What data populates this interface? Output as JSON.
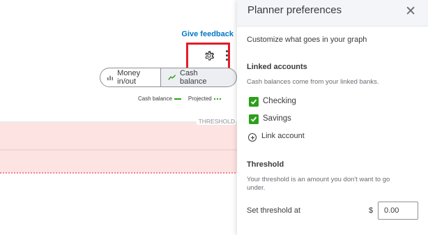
{
  "left": {
    "feedback_label": "Give feedback",
    "toggle": {
      "money_label": "Money in/out",
      "cash_label": "Cash balance"
    },
    "legend": {
      "cash_balance": "Cash balance",
      "projected": "Projected"
    },
    "threshold_label": "THRESHOLD"
  },
  "panel": {
    "title": "Planner preferences",
    "close_glyph": "✕",
    "customize": "Customize what goes in your graph",
    "linked": {
      "heading": "Linked accounts",
      "description": "Cash balances come from your linked banks.",
      "accounts": [
        {
          "label": "Checking",
          "checked": true
        },
        {
          "label": "Savings",
          "checked": true
        }
      ],
      "link_account": "Link account"
    },
    "threshold": {
      "heading": "Threshold",
      "description_line1": "Your threshold is an amount you don't want to go",
      "description_line2": "under.",
      "set_label": "Set threshold at",
      "currency": "$",
      "value": "0.00"
    }
  },
  "colors": {
    "accent_green": "#2ca01c",
    "link_blue": "#0077c5",
    "highlight_red": "#e31d2a",
    "threshold_fill": "#fde3e1"
  },
  "icons": [
    "gear-icon",
    "more-vertical-icon",
    "bar-chart-icon",
    "line-chart-icon",
    "close-icon",
    "checkbox-check-icon",
    "plus-circle-icon"
  ]
}
